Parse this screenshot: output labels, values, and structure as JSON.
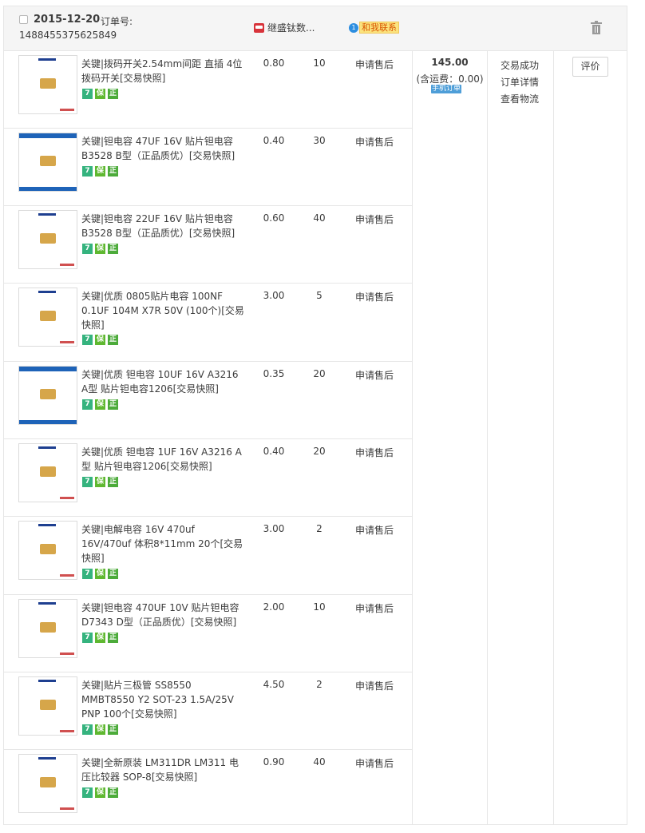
{
  "order": {
    "date": "2015-12-20",
    "order_no_label": "订单号:",
    "order_no": "1488455375625849",
    "shop": "继盛钛数...",
    "contact": "和我联系",
    "contact_icon_text": "1",
    "total": "145.00",
    "shipping": "(含运费：0.00)",
    "mobile_tag": "手机订单",
    "status": [
      "交易成功",
      "订单详情",
      "查看物流"
    ],
    "action": "评价",
    "icons": {
      "checkbox": "checkbox-icon",
      "shop": "shop-icon",
      "chat": "wangwang-icon",
      "delete": "trash-icon"
    }
  },
  "items": [
    {
      "name": "关键|拨码开关2.54mm间距 直插 4位拨码开关[交易快照]",
      "price": "0.80",
      "qty": "10",
      "after": "申请售后",
      "badges": [
        "7",
        "保",
        "正"
      ]
    },
    {
      "name": "关键|钽电容 47UF 16V 贴片钽电容 B3528 B型（正品质优）[交易快照]",
      "price": "0.40",
      "qty": "30",
      "after": "申请售后",
      "badges": [
        "7",
        "保",
        "正"
      ]
    },
    {
      "name": "关键|钽电容 22UF 16V 贴片钽电容 B3528 B型（正品质优）[交易快照]",
      "price": "0.60",
      "qty": "40",
      "after": "申请售后",
      "badges": [
        "7",
        "保",
        "正"
      ]
    },
    {
      "name": "关键|优质 0805贴片电容 100NF 0.1UF 104M X7R 50V (100个)[交易快照]",
      "price": "3.00",
      "qty": "5",
      "after": "申请售后",
      "badges": [
        "7",
        "保",
        "正"
      ]
    },
    {
      "name": "关键|优质 钽电容 10UF 16V A3216 A型 贴片钽电容1206[交易快照]",
      "price": "0.35",
      "qty": "20",
      "after": "申请售后",
      "badges": [
        "7",
        "保",
        "正"
      ]
    },
    {
      "name": "关键|优质 钽电容 1UF 16V A3216 A型 贴片钽电容1206[交易快照]",
      "price": "0.40",
      "qty": "20",
      "after": "申请售后",
      "badges": [
        "7",
        "保",
        "正"
      ]
    },
    {
      "name": "关键|电解电容 16V 470uf 16V/470uf 体积8*11mm 20个[交易快照]",
      "price": "3.00",
      "qty": "2",
      "after": "申请售后",
      "badges": [
        "7",
        "保",
        "正"
      ]
    },
    {
      "name": "关键|钽电容 470UF 10V 贴片钽电容 D7343 D型（正品质优）[交易快照]",
      "price": "2.00",
      "qty": "10",
      "after": "申请售后",
      "badges": [
        "7",
        "保",
        "正"
      ]
    },
    {
      "name": "关键|贴片三极管 SS8550 MMBT8550 Y2 SOT-23 1.5A/25V PNP 100个[交易快照]",
      "price": "4.50",
      "qty": "2",
      "after": "申请售后",
      "badges": [
        "7",
        "保",
        "正"
      ]
    },
    {
      "name": "关键|全新原装 LM311DR LM311 电压比较器 SOP-8[交易快照]",
      "price": "0.90",
      "qty": "40",
      "after": "申请售后",
      "badges": [
        "7",
        "保",
        "正"
      ]
    }
  ]
}
